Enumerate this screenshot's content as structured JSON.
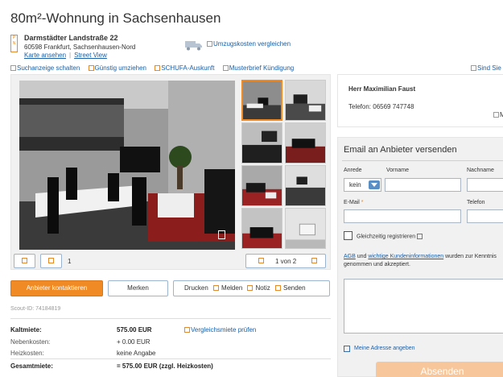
{
  "title": "80m²-Wohnung in Sachsenhausen",
  "address": {
    "street": "Darmstädter Landstraße 22",
    "city": "60598 Frankfurt, Sachsenhausen-Nord",
    "map_link": "Karte ansehen",
    "street_view_link": "Street View"
  },
  "umzug_link": "Umzugskosten vergleichen",
  "actions": [
    "Suchanzeige schalten",
    "Günstig umziehen",
    "SCHUFA-Auskunft",
    "Musterbrief Kündigung"
  ],
  "sie_sind": "Sind Sie",
  "gallery": {
    "count": "1",
    "pager": "1 von 2"
  },
  "buttons": {
    "contact": "Anbieter kontaktieren",
    "merken": "Merken",
    "drucken": "Drucken",
    "melden": "Melden",
    "notiz": "Notiz",
    "senden": "Senden"
  },
  "scout_id": "Scout-ID: 74184819",
  "costs": {
    "kaltmiete_label": "Kaltmiete:",
    "kaltmiete_value": "575.00 EUR",
    "vergleich_link": "Vergleichsmiete prüfen",
    "nebenkosten_label": "Nebenkosten:",
    "nebenkosten_value": "+ 0.00 EUR",
    "heizkosten_label": "Heizkosten:",
    "heizkosten_value": "keine Angabe",
    "gesamtmiete_label": "Gesamtmiete:",
    "gesamtmiete_value": "= 575.00 EUR (zzgl. Heizkosten)"
  },
  "agent": {
    "name": "Herr Maximilian Faust",
    "phone": "Telefon: 06569 747748",
    "more": "M"
  },
  "form": {
    "title": "Email an Anbieter versenden",
    "anrede_label": "Anrede",
    "anrede_value": "kein",
    "vorname_label": "Vorname",
    "nachname_label": "Nachname",
    "email_label": "E-Mail",
    "required_mark": "*",
    "telefon_label": "Telefon",
    "register_label": "Gleichzeitig registrieren",
    "agb_link": "AGB",
    "agb_und": " und ",
    "kunden_link": "wichtige Kundeninformationen",
    "agb_rest": " wurden zur Kenntnis genommen und akzeptiert.",
    "address_label": "Meine Adresse angeben",
    "send_button": "Absenden"
  },
  "colors": {
    "accent": "#f08a24",
    "link": "#1a5fa8"
  }
}
